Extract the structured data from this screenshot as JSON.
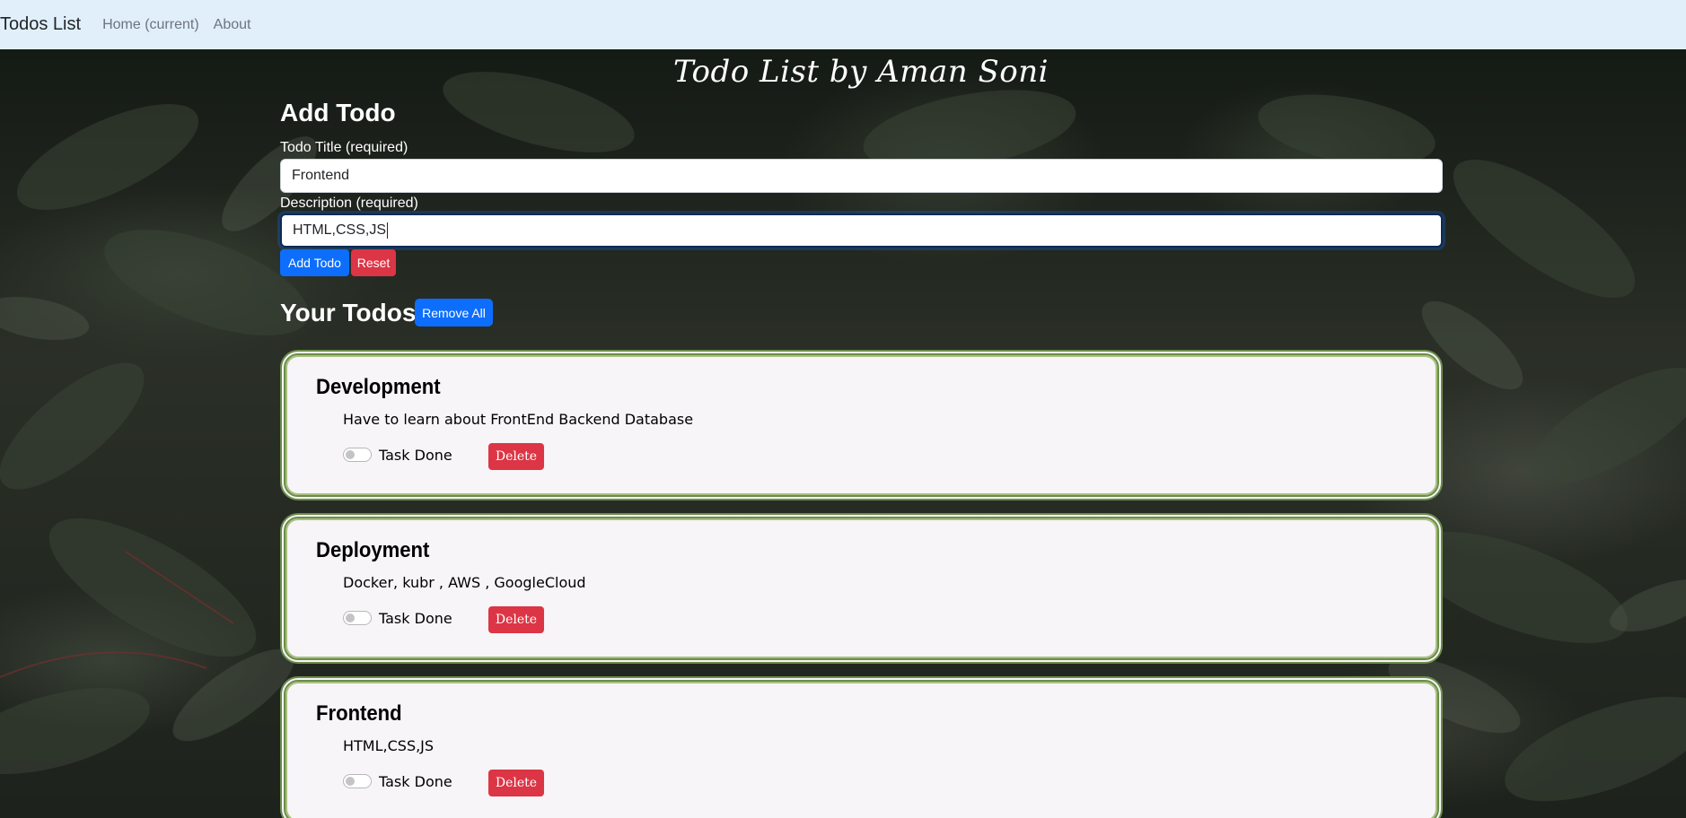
{
  "navbar": {
    "brand": "Todos List",
    "links": [
      "Home (current)",
      "About"
    ]
  },
  "page_title": "Todo List by Aman Soni",
  "form": {
    "heading": "Add Todo",
    "title_label": "Todo Title (required)",
    "title_value": "Frontend",
    "desc_label": "Description (required)",
    "desc_value": "HTML,CSS,JS",
    "add_button": "Add Todo",
    "reset_button": "Reset"
  },
  "todos_section": {
    "heading": "Your Todos",
    "remove_all_button": "Remove All"
  },
  "todos": [
    {
      "title": "Development",
      "description": "Have to learn about FrontEnd Backend Database",
      "done_label": "Task Done",
      "delete_label": "Delete"
    },
    {
      "title": "Deployment",
      "description": "Docker, kubr , AWS , GoogleCloud",
      "done_label": "Task Done",
      "delete_label": "Delete"
    },
    {
      "title": "Frontend",
      "description": "HTML,CSS,JS",
      "done_label": "Task Done",
      "delete_label": "Delete"
    }
  ],
  "colors": {
    "navbar_bg": "#e1effb",
    "primary": "#0d6efd",
    "danger": "#dc3545",
    "card_border": "#6b8c4a"
  }
}
